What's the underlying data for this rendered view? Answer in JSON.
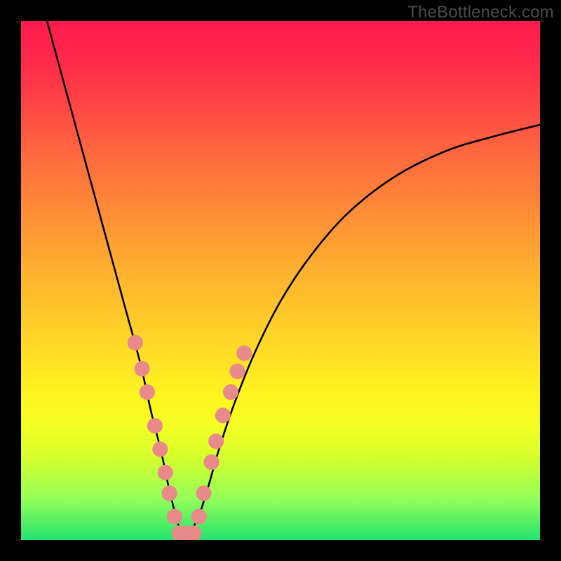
{
  "watermark": "TheBottleneck.com",
  "chart_data": {
    "type": "line",
    "title": "",
    "xlabel": "",
    "ylabel": "",
    "xlim": [
      0,
      100
    ],
    "ylim": [
      0,
      100
    ],
    "gradient_stops": [
      {
        "pos": 0,
        "color": "#ff1a4d"
      },
      {
        "pos": 8,
        "color": "#ff2a4a"
      },
      {
        "pos": 16,
        "color": "#ff4545"
      },
      {
        "pos": 26,
        "color": "#ff6a3e"
      },
      {
        "pos": 36,
        "color": "#ff8a37"
      },
      {
        "pos": 48,
        "color": "#ffb02f"
      },
      {
        "pos": 60,
        "color": "#ffd228"
      },
      {
        "pos": 72,
        "color": "#fff420"
      },
      {
        "pos": 78,
        "color": "#f4ff24"
      },
      {
        "pos": 84,
        "color": "#d6ff2c"
      },
      {
        "pos": 92,
        "color": "#95ff58"
      },
      {
        "pos": 100,
        "color": "#23e36e"
      }
    ],
    "series": [
      {
        "name": "bottleneck-curve",
        "x": [
          5,
          8,
          11,
          14,
          17,
          20,
          23,
          25,
          27,
          28.5,
          30,
          31,
          32,
          34,
          36,
          38,
          41,
          45,
          50,
          56,
          63,
          72,
          82,
          92,
          100
        ],
        "y": [
          100,
          89,
          78,
          67,
          56,
          45,
          34,
          25,
          17,
          10,
          4,
          1,
          1,
          4,
          10,
          17,
          26,
          36,
          46,
          55,
          63,
          70,
          75,
          78,
          80
        ]
      }
    ],
    "markers": {
      "name": "highlight-dots",
      "color": "#e98a8a",
      "radius_pct": 1.5,
      "points": [
        {
          "x": 22.0,
          "y": 38.0
        },
        {
          "x": 23.3,
          "y": 33.0
        },
        {
          "x": 24.3,
          "y": 28.5
        },
        {
          "x": 25.8,
          "y": 22.0
        },
        {
          "x": 26.8,
          "y": 17.5
        },
        {
          "x": 27.8,
          "y": 13.0
        },
        {
          "x": 28.6,
          "y": 9.0
        },
        {
          "x": 29.6,
          "y": 4.5
        },
        {
          "x": 30.5,
          "y": 1.3
        },
        {
          "x": 31.9,
          "y": 1.3
        },
        {
          "x": 33.3,
          "y": 1.3
        },
        {
          "x": 34.3,
          "y": 4.5
        },
        {
          "x": 35.2,
          "y": 9.0
        },
        {
          "x": 36.7,
          "y": 15.0
        },
        {
          "x": 37.6,
          "y": 19.0
        },
        {
          "x": 38.9,
          "y": 24.0
        },
        {
          "x": 40.4,
          "y": 28.5
        },
        {
          "x": 41.7,
          "y": 32.5
        },
        {
          "x": 43.0,
          "y": 36.0
        }
      ]
    }
  }
}
